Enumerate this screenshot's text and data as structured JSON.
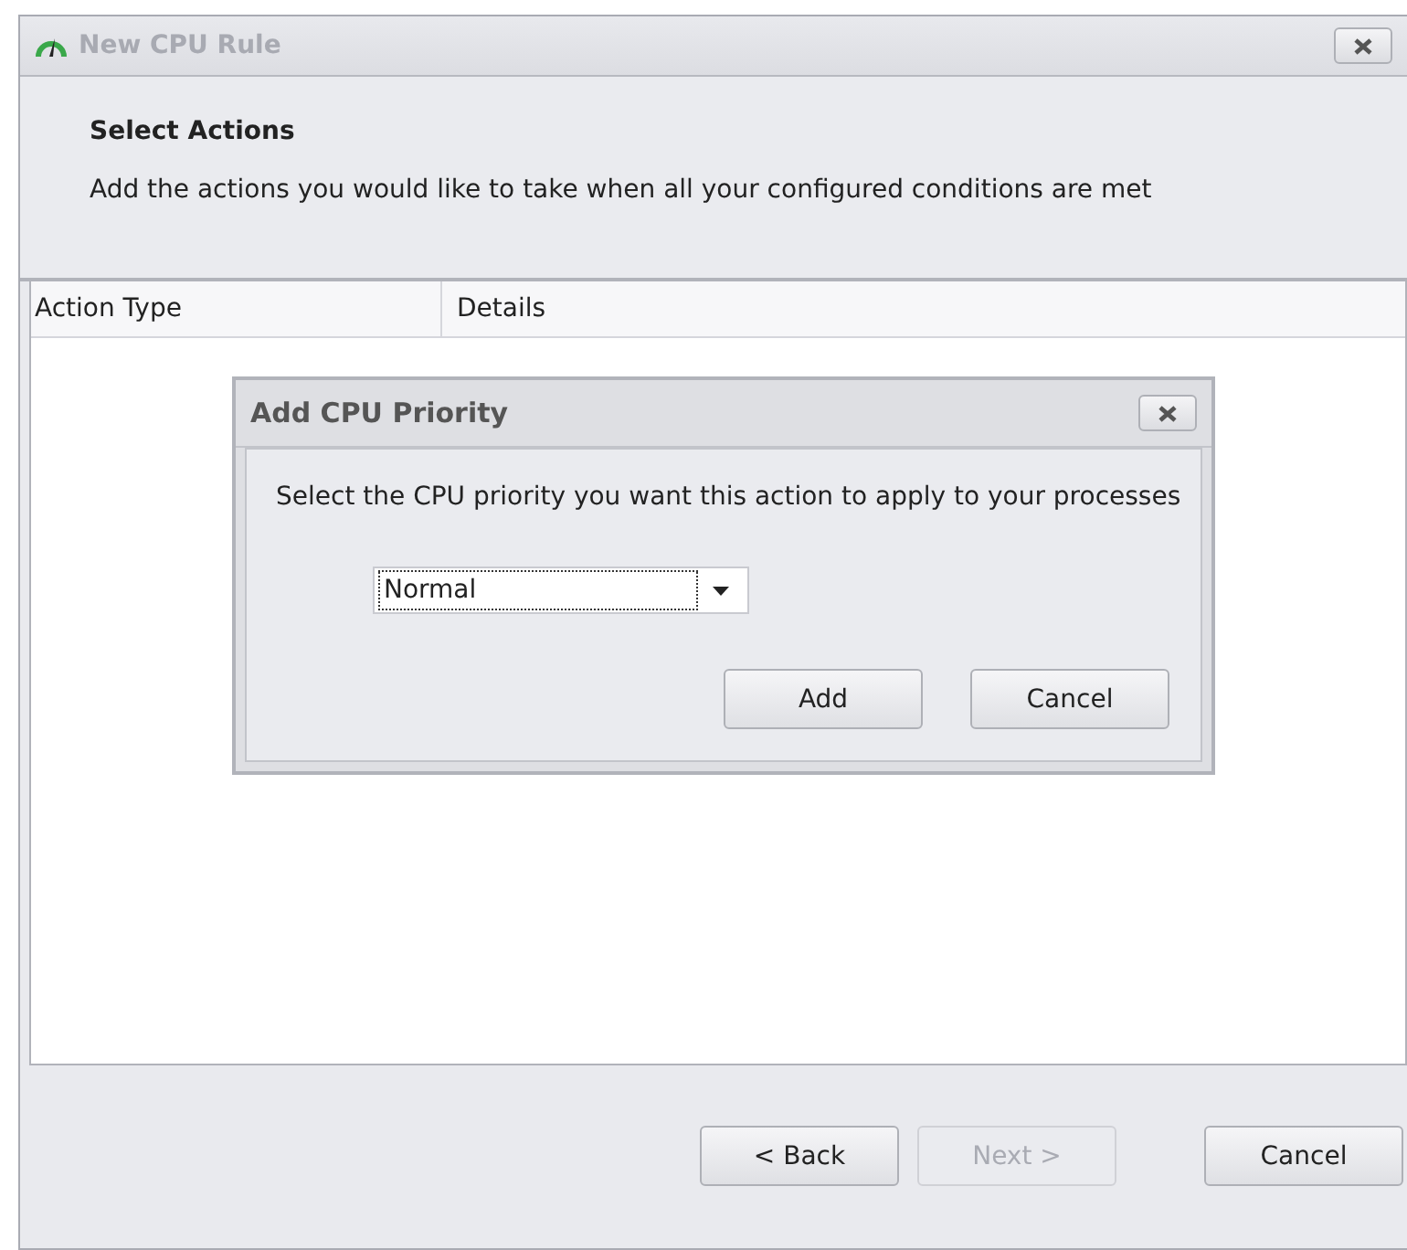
{
  "window": {
    "title": "New CPU Rule"
  },
  "header": {
    "title": "Select Actions",
    "description": "Add the actions you would like to take when all your configured conditions are met"
  },
  "table": {
    "columns": [
      "Action Type",
      "Details"
    ]
  },
  "dialog": {
    "title": "Add CPU Priority",
    "prompt": "Select the CPU priority you want this action to apply to your processes",
    "priority": {
      "value": "Normal"
    },
    "buttons": [
      {
        "label": "Add",
        "disabled": false
      },
      {
        "label": "Cancel",
        "disabled": false
      }
    ]
  },
  "buttons": [
    {
      "label": "< Back",
      "disabled": false
    },
    {
      "label": "Next >",
      "disabled": true
    },
    {
      "label": "Cancel",
      "disabled": false
    }
  ]
}
